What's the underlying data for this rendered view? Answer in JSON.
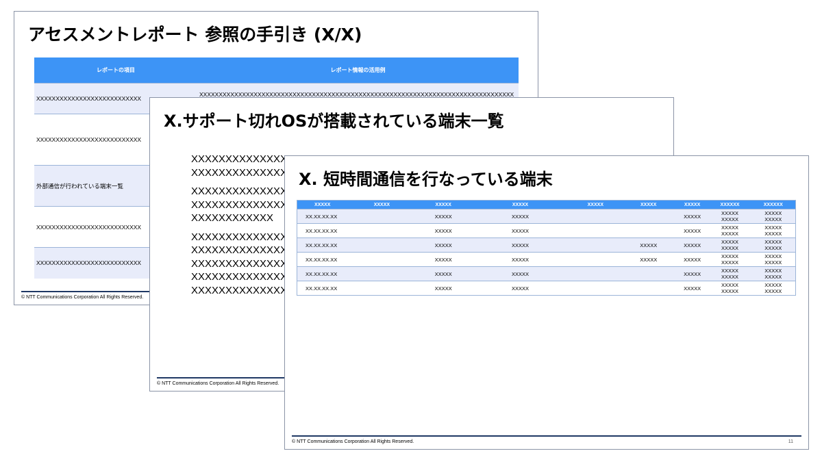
{
  "slide1": {
    "title": "アセスメントレポート 参照の手引き (X/X)",
    "headers": [
      "レポートの項目",
      "レポート情報の活用例"
    ],
    "rows": [
      [
        "XXXXXXXXXXXXXXXXXXXXXXXXXXX",
        "XXXXXXXXXXXXXXXXXXXXXXXXXXXXXXXXXXXXXXXXXXXXXXXXXXXXXXXXXXXXXXXXXXXXXXXXXXXXXXXXXXXXXXXXXXXXXXXXXXXXXXXXXXXXXXXXXXXXXXXXXXXXXXXX"
      ],
      [
        "XXXXXXXXXXXXXXXXXXXXXXXXXXX",
        ""
      ],
      [
        "外部通信が行われている端末一覧",
        ""
      ],
      [
        "XXXXXXXXXXXXXXXXXXXXXXXXXXX",
        ""
      ],
      [
        "XXXXXXXXXXXXXXXXXXXXXXXXXXX",
        ""
      ]
    ],
    "footer": "© NTT Communications Corporation All Rights Reserved."
  },
  "slide2": {
    "title": "X.サポート切れOSが搭載されている端末一覧",
    "paragraphs": [
      [
        "XXXXXXXXXXXXXXXXXXXXXXXXXXXXXXXX",
        "XXXXXXXXXXXXXXXXXXXXXXXXXXXXXXXX"
      ],
      [
        "XXXXXXXXXXXXXXXXXXXXXXXXXXXXXXXX",
        "XXXXXXXXXXXXXXXXXXXXXXXXXXXXXXXX",
        "XXXXXXXXXXXX"
      ],
      [
        "XXXXXXXXXXXXXXXXXXXXXXXXXXXXXXXX",
        "XXXXXXXXXXXXXXXXXXXXXXXXXXXXXXXX",
        "XXXXXXXXXXXXXXXXXXXXXXXXXXXXXXXX",
        "XXXXXXXXXXXXXXXXXXXXXXXXXXXXXXXX",
        "XXXXXXXXXXXXXXXXXXXXXXXXXXXXXXXX"
      ]
    ],
    "footer": "© NTT Communications Corporation All Rights Reserved."
  },
  "slide3": {
    "title": "X. 短時間通信を行なっている端末",
    "headers": [
      "XXXXX",
      "XXXXX",
      "XXXXX",
      "XXXXX",
      "XXXXX",
      "XXXXX",
      "XXXXX",
      "XXXXXX",
      "XXXXXX"
    ],
    "rows": [
      [
        "XX.XX.XX.XX",
        "",
        "XXXXX",
        "XXXXX",
        "",
        "",
        "XXXXX",
        "XXXXX\nXXXXX",
        "XXXXX\nXXXXX"
      ],
      [
        "XX.XX.XX.XX",
        "",
        "XXXXX",
        "XXXXX",
        "",
        "",
        "XXXXX",
        "XXXXX\nXXXXX",
        "XXXXX\nXXXXX"
      ],
      [
        "XX.XX.XX.XX",
        "",
        "XXXXX",
        "XXXXX",
        "",
        "XXXXX",
        "XXXXX",
        "XXXXX\nXXXXX",
        "XXXXX\nXXXXX"
      ],
      [
        "XX.XX.XX.XX",
        "",
        "XXXXX",
        "XXXXX",
        "",
        "XXXXX",
        "XXXXX",
        "XXXXX\nXXXXX",
        "XXXXX\nXXXXX"
      ],
      [
        "XX.XX.XX.XX",
        "",
        "XXXXX",
        "XXXXX",
        "",
        "",
        "XXXXX",
        "XXXXX\nXXXXX",
        "XXXXX\nXXXXX"
      ],
      [
        "XX.XX.XX.XX",
        "",
        "XXXXX",
        "XXXXX",
        "",
        "",
        "XXXXX",
        "XXXXX\nXXXXX",
        "XXXXX\nXXXXX"
      ]
    ],
    "footer": "© NTT Communications Corporation All Rights Reserved.",
    "page_number": "11"
  },
  "colors": {
    "table_header": "#3d94f6",
    "row_alt": "#e8ecfa",
    "footer_line": "#1f3864"
  }
}
